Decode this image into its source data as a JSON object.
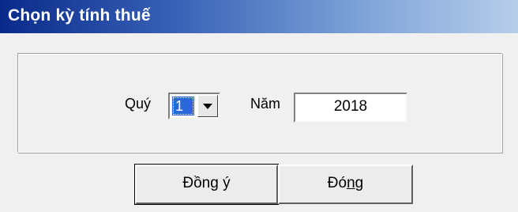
{
  "window": {
    "title": "Chọn kỳ tính thuế"
  },
  "form": {
    "quarter_label": "Quý",
    "quarter_value": "1",
    "year_label": "Năm",
    "year_value": "2018"
  },
  "buttons": {
    "agree_label": "Đồng ý",
    "close_label_prefix": "Đó",
    "close_label_mnemonic": "n",
    "close_label_suffix": "g"
  },
  "icons": {
    "dropdown": "chevron-down-icon"
  }
}
